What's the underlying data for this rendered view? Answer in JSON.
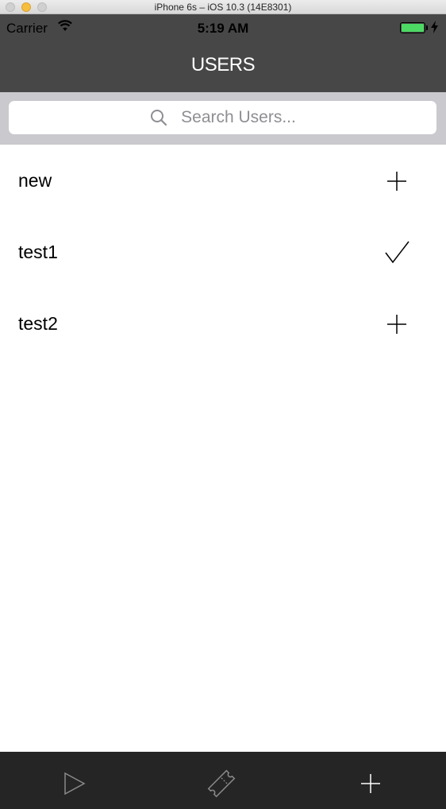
{
  "window": {
    "title": "iPhone 6s – iOS 10.3 (14E8301)"
  },
  "status_bar": {
    "carrier": "Carrier",
    "time": "5:19 AM",
    "battery_color": "#4cd964"
  },
  "nav": {
    "title": "USERS",
    "background": "#474747"
  },
  "search": {
    "placeholder": "Search Users...",
    "value": ""
  },
  "users": [
    {
      "name": "new",
      "action_icon": "plus-icon"
    },
    {
      "name": "test1",
      "action_icon": "checkmark-icon"
    },
    {
      "name": "test2",
      "action_icon": "plus-icon"
    }
  ],
  "tab_bar": {
    "background": "#252525",
    "items": [
      {
        "icon": "play-icon"
      },
      {
        "icon": "ticket-icon"
      },
      {
        "icon": "plus-icon"
      }
    ]
  }
}
